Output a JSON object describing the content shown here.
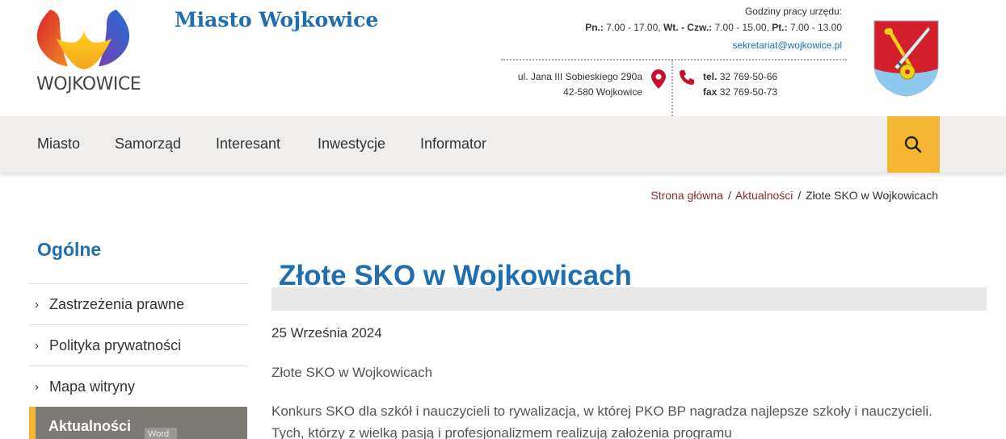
{
  "header": {
    "logo_text": "WOJKOWICE",
    "site_title": "Miasto Wojkowice",
    "hours_title": "Godziny pracy urzędu:",
    "hours": [
      {
        "day": "Pn.:",
        "time": "7.00 - 17.00,"
      },
      {
        "day": "Wt. - Czw.:",
        "time": "7.00 - 15.00,"
      },
      {
        "day": "Pt.:",
        "time": "7.00 - 13.00"
      }
    ],
    "email": "sekretariat@wojkowice.pl",
    "address_line1": "ul. Jana III Sobieskiego 290a",
    "address_line2": "42-580 Wojkowice",
    "tel_label": "tel.",
    "tel_value": "32 769-50-66",
    "fax_label": "fax",
    "fax_value": "32 769-50-73"
  },
  "nav": {
    "items": [
      "Miasto",
      "Samorząd",
      "Interesant",
      "Inwestycje",
      "Informator"
    ],
    "search_icon": "search-icon"
  },
  "breadcrumb": {
    "items": [
      "Strona główna",
      "Aktualności",
      "Złote SKO w Wojkowicach"
    ],
    "separator": "/"
  },
  "sidebar": {
    "title": "Ogólne",
    "items": [
      "Zastrzeżenia prawne",
      "Polityka prywatności",
      "Mapa witryny"
    ],
    "active_item": "Aktualności",
    "word_tag": "Word"
  },
  "main": {
    "title": "Złote SKO w Wojkowicach",
    "date": "25 Września 2024",
    "subtitle": "Złote SKO w Wojkowicach",
    "paragraph": "Konkurs SKO dla szkół i nauczycieli to rywalizacja, w której PKO BP nagradza najlepsze szkoły i nauczycieli. Tych, którzy z wielką pasją i profesjonalizmem realizują założenia programu"
  },
  "colors": {
    "brand_blue": "#1f6fb0",
    "accent_yellow": "#f4b633",
    "breadcrumb_link": "#8a2a33",
    "nav_bg": "#efeeed"
  }
}
